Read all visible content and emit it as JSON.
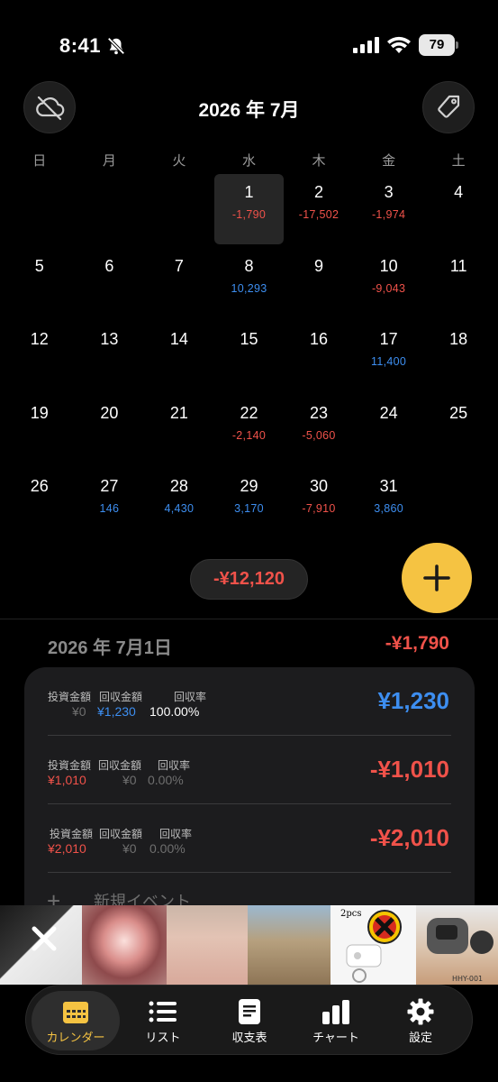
{
  "status_bar": {
    "time": "8:41",
    "battery": "79"
  },
  "header": {
    "month_title": "2026 年 7月"
  },
  "weekdays": [
    "日",
    "月",
    "火",
    "水",
    "木",
    "金",
    "土"
  ],
  "calendar": {
    "weeks": [
      [
        {
          "day": "",
          "amount": "",
          "sign": ""
        },
        {
          "day": "",
          "amount": "",
          "sign": ""
        },
        {
          "day": "",
          "amount": "",
          "sign": ""
        },
        {
          "day": "1",
          "amount": "-1,790",
          "sign": "neg",
          "selected": true
        },
        {
          "day": "2",
          "amount": "-17,502",
          "sign": "neg"
        },
        {
          "day": "3",
          "amount": "-1,974",
          "sign": "neg"
        },
        {
          "day": "4",
          "amount": "",
          "sign": ""
        }
      ],
      [
        {
          "day": "5",
          "amount": "",
          "sign": ""
        },
        {
          "day": "6",
          "amount": "",
          "sign": ""
        },
        {
          "day": "7",
          "amount": "",
          "sign": ""
        },
        {
          "day": "8",
          "amount": "10,293",
          "sign": "pos"
        },
        {
          "day": "9",
          "amount": "",
          "sign": ""
        },
        {
          "day": "10",
          "amount": "-9,043",
          "sign": "neg"
        },
        {
          "day": "11",
          "amount": "",
          "sign": ""
        }
      ],
      [
        {
          "day": "12",
          "amount": "",
          "sign": ""
        },
        {
          "day": "13",
          "amount": "",
          "sign": ""
        },
        {
          "day": "14",
          "amount": "",
          "sign": ""
        },
        {
          "day": "15",
          "amount": "",
          "sign": ""
        },
        {
          "day": "16",
          "amount": "",
          "sign": ""
        },
        {
          "day": "17",
          "amount": "11,400",
          "sign": "pos"
        },
        {
          "day": "18",
          "amount": "",
          "sign": ""
        }
      ],
      [
        {
          "day": "19",
          "amount": "",
          "sign": ""
        },
        {
          "day": "20",
          "amount": "",
          "sign": ""
        },
        {
          "day": "21",
          "amount": "",
          "sign": ""
        },
        {
          "day": "22",
          "amount": "-2,140",
          "sign": "neg"
        },
        {
          "day": "23",
          "amount": "-5,060",
          "sign": "neg"
        },
        {
          "day": "24",
          "amount": "",
          "sign": ""
        },
        {
          "day": "25",
          "amount": "",
          "sign": ""
        }
      ],
      [
        {
          "day": "26",
          "amount": "",
          "sign": ""
        },
        {
          "day": "27",
          "amount": "146",
          "sign": "pos"
        },
        {
          "day": "28",
          "amount": "4,430",
          "sign": "pos"
        },
        {
          "day": "29",
          "amount": "3,170",
          "sign": "pos"
        },
        {
          "day": "30",
          "amount": "-7,910",
          "sign": "neg"
        },
        {
          "day": "31",
          "amount": "3,860",
          "sign": "pos"
        },
        {
          "day": "",
          "amount": "",
          "sign": ""
        }
      ]
    ]
  },
  "month_total": "-¥12,120",
  "detail": {
    "date": "2026 年 7月1日",
    "total": "-¥1,790",
    "labels": {
      "invest": "投資金額",
      "return": "回収金額",
      "rate": "回収率"
    },
    "records": [
      {
        "invest": "¥0",
        "return": "¥1,230",
        "rate": "100.00%",
        "amount": "¥1,230",
        "amount_sign": "pos"
      },
      {
        "invest": "¥1,010",
        "return": "¥0",
        "rate": "0.00%",
        "amount": "-¥1,010",
        "amount_sign": "neg"
      },
      {
        "invest": "¥2,010",
        "return": "¥0",
        "rate": "0.00%",
        "amount": "-¥2,010",
        "amount_sign": "neg"
      }
    ],
    "new_event_label": "新規イベント"
  },
  "ad": {
    "caption": "2pcs",
    "caption2": "HHY-001"
  },
  "tabs": [
    {
      "label": "カレンダー",
      "icon": "calendar-icon",
      "active": true
    },
    {
      "label": "リスト",
      "icon": "list-icon"
    },
    {
      "label": "収支表",
      "icon": "document-icon"
    },
    {
      "label": "チャート",
      "icon": "bar-chart-icon"
    },
    {
      "label": "設定",
      "icon": "gear-icon"
    }
  ],
  "colors": {
    "accent": "#f5c342",
    "negative": "#f0524a",
    "positive": "#3d8ef0",
    "background": "#000000"
  }
}
